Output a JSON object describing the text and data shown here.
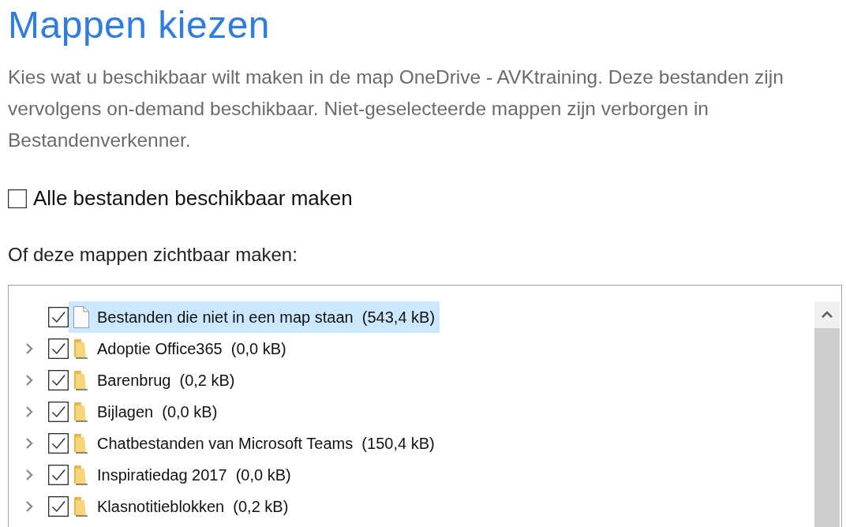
{
  "title": "Mappen kiezen",
  "description": "Kies wat u beschikbaar wilt maken in de map OneDrive - AVKtraining. Deze bestanden zijn vervolgens on-demand beschikbaar. Niet-geselecteerde mappen zijn verborgen in Bestandenverkenner.",
  "all_files": {
    "label": "Alle bestanden beschikbaar maken",
    "checked": false
  },
  "folders_heading": "Of deze mappen zichtbaar maken:",
  "tree": [
    {
      "kind": "file",
      "label": "Bestanden die niet in een map staan  (543,4 kB)",
      "checked": true,
      "selected": true,
      "expandable": false
    },
    {
      "kind": "folder",
      "label": "Adoptie Office365  (0,0 kB)",
      "checked": true,
      "selected": false,
      "expandable": true
    },
    {
      "kind": "folder",
      "label": "Barenbrug  (0,2 kB)",
      "checked": true,
      "selected": false,
      "expandable": true
    },
    {
      "kind": "folder",
      "label": "Bijlagen  (0,0 kB)",
      "checked": true,
      "selected": false,
      "expandable": true
    },
    {
      "kind": "folder",
      "label": "Chatbestanden van Microsoft Teams  (150,4 kB)",
      "checked": true,
      "selected": false,
      "expandable": true
    },
    {
      "kind": "folder",
      "label": "Inspiratiedag 2017  (0,0 kB)",
      "checked": true,
      "selected": false,
      "expandable": true
    },
    {
      "kind": "folder",
      "label": "Klasnotitieblokken  (0,2 kB)",
      "checked": true,
      "selected": false,
      "expandable": true
    }
  ]
}
